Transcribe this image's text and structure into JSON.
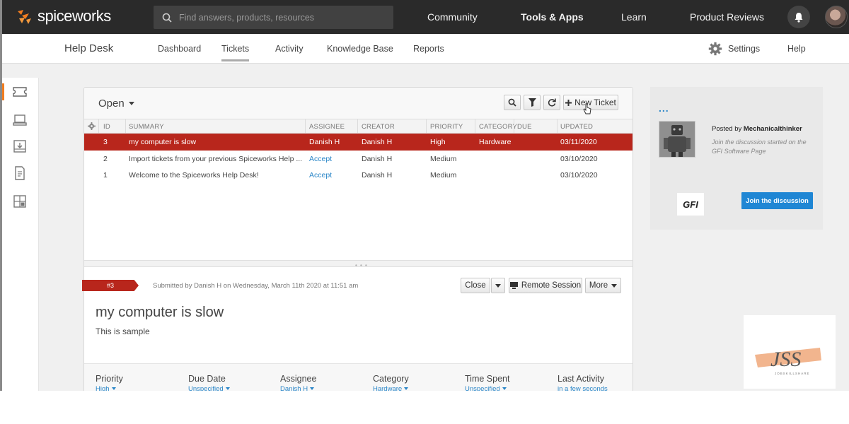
{
  "brand": {
    "name": "spiceworks",
    "accent": "#f07c1f"
  },
  "search": {
    "placeholder": "Find answers, products, resources"
  },
  "topnav": {
    "community": "Community",
    "tools": "Tools & Apps",
    "learn": "Learn",
    "reviews": "Product Reviews"
  },
  "subnav": {
    "title": "Help Desk",
    "tabs": [
      "Dashboard",
      "Tickets",
      "Activity",
      "Knowledge Base",
      "Reports"
    ],
    "active_tab": "Tickets",
    "settings": "Settings",
    "help": "Help"
  },
  "rail": {
    "icons": [
      "ticket-icon",
      "laptop-icon",
      "inbox-icon",
      "report-icon",
      "dashboard-icon"
    ]
  },
  "tickets": {
    "filter": "Open",
    "new_ticket": "New Ticket",
    "columns": [
      "ID",
      "SUMMARY",
      "ASSIGNEE",
      "CREATOR",
      "PRIORITY",
      "CATEGORY",
      "DUE",
      "UPDATED"
    ],
    "rows": [
      {
        "id": "3",
        "summary": "my computer is slow",
        "assignee": "Danish H",
        "creator": "Danish H",
        "priority": "High",
        "category": "Hardware",
        "due": "",
        "updated": "03/11/2020",
        "selected": true
      },
      {
        "id": "2",
        "summary": "Import tickets from your previous Spiceworks Help ...",
        "assignee": "Accept",
        "creator": "Danish H",
        "priority": "Medium",
        "category": "",
        "due": "",
        "updated": "03/10/2020",
        "selected": false
      },
      {
        "id": "1",
        "summary": "Welcome to the Spiceworks Help Desk!",
        "assignee": "Accept",
        "creator": "Danish H",
        "priority": "Medium",
        "category": "",
        "due": "",
        "updated": "03/10/2020",
        "selected": false
      }
    ],
    "selected_color": "#b8261c"
  },
  "detail": {
    "badge": "#3",
    "submitted": "Submitted by Danish H on Wednesday, March 11th 2020 at 11:51 am",
    "close": "Close",
    "remote": "Remote Session",
    "more": "More",
    "title": "my computer is slow",
    "body": "This is sample",
    "fields": [
      {
        "label": "Priority",
        "value": "High"
      },
      {
        "label": "Due Date",
        "value": "Unspecified"
      },
      {
        "label": "Assignee",
        "value": "Danish H"
      },
      {
        "label": "Category",
        "value": "Hardware"
      },
      {
        "label": "Time Spent",
        "value": "Unspecified"
      },
      {
        "label": "Last Activity",
        "value": "in a few seconds"
      }
    ]
  },
  "promo": {
    "dots": "...",
    "posted_prefix": "Posted by",
    "author": "Mechanicalthinker",
    "desc": "Join the discussion started on the GFI Software Page",
    "logo": "GFI",
    "join": "Join the discussion"
  },
  "watermark": {
    "logo": "JSS",
    "text": "JOBSKILLSHARE"
  }
}
